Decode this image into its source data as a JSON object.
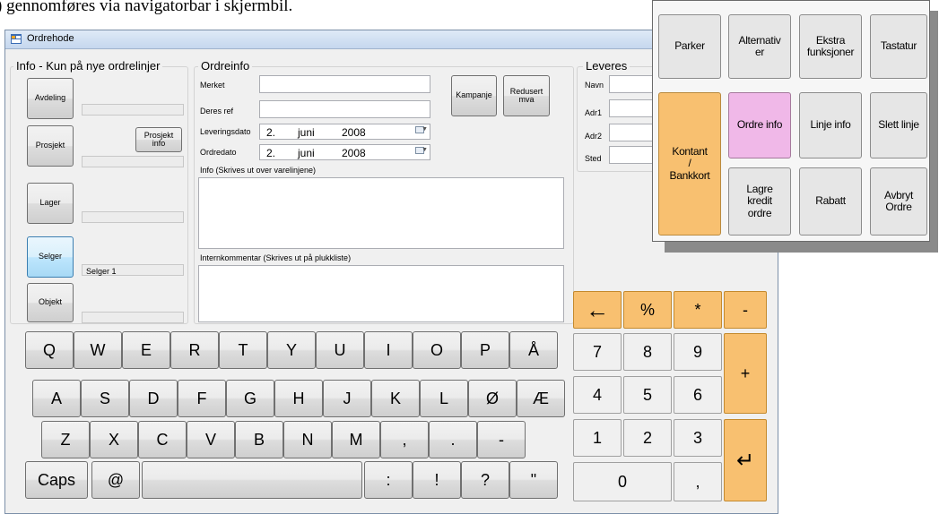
{
  "caption": ") gennomføres via navigatorbar i skjermbil.",
  "window": {
    "title": "Ordrehode"
  },
  "info_group": {
    "title": "Info - Kun på nye ordrelinjer",
    "avdeling": "Avdeling",
    "prosjekt": "Prosjekt",
    "prosjekt_info": "Prosjekt\ninfo",
    "lager": "Lager",
    "selger": "Selger",
    "selger_value": "Selger 1",
    "objekt": "Objekt"
  },
  "ordreinfo": {
    "title": "Ordreinfo",
    "merket_label": "Merket",
    "deres_ref_label": "Deres ref",
    "leveringsdato_label": "Leveringsdato",
    "ordredato_label": "Ordredato",
    "leveringsdato": {
      "day": "2.",
      "month": "juni",
      "year": "2008"
    },
    "ordredato": {
      "day": "2.",
      "month": "juni",
      "year": "2008"
    },
    "kampanje": "Kampanje",
    "redusert_mva": "Redusert\nmva",
    "info_label": "Info (Skrives ut over varelinjene)",
    "intern_label": "Internkommentar (Skrives ut på plukkliste)"
  },
  "leveres": {
    "title": "Leveres",
    "navn": "Navn",
    "adr1": "Adr1",
    "adr2": "Adr2",
    "sted": "Sted"
  },
  "keyboard": {
    "row1": [
      "Q",
      "W",
      "E",
      "R",
      "T",
      "Y",
      "U",
      "I",
      "O",
      "P",
      "Å"
    ],
    "row2": [
      "A",
      "S",
      "D",
      "F",
      "G",
      "H",
      "J",
      "K",
      "L",
      "Ø",
      "Æ"
    ],
    "row3": [
      "Z",
      "X",
      "C",
      "V",
      "B",
      "N",
      "M",
      ",",
      ".",
      "-"
    ],
    "caps": "Caps",
    "at": "@",
    "colon": ":",
    "exclaim": "!",
    "question": "?",
    "quote": "\""
  },
  "numpad": {
    "backspace": "←",
    "percent": "%",
    "star": "*",
    "minus": "-",
    "seven": "7",
    "eight": "8",
    "nine": "9",
    "plus": "+",
    "four": "4",
    "five": "5",
    "six": "6",
    "one": "1",
    "two": "2",
    "three": "3",
    "enter": "↵",
    "zero": "0",
    "comma": ","
  },
  "popup": {
    "parker": "Parker",
    "alternativer": "Alternativ\ner",
    "ekstra": "Ekstra\nfunksjoner",
    "tastatur": "Tastatur",
    "kontant": "Kontant\n/\nBankkort",
    "ordre_info": "Ordre info",
    "linje_info": "Linje info",
    "slett_linje": "Slett linje",
    "lagre": "Lagre\nkredit\nordre",
    "rabatt": "Rabatt",
    "avbryt": "Avbryt\nOrdre"
  },
  "colors": {
    "orange": "#f8c070",
    "pink": "#f0b8e8",
    "selected": "#bee6fd"
  }
}
